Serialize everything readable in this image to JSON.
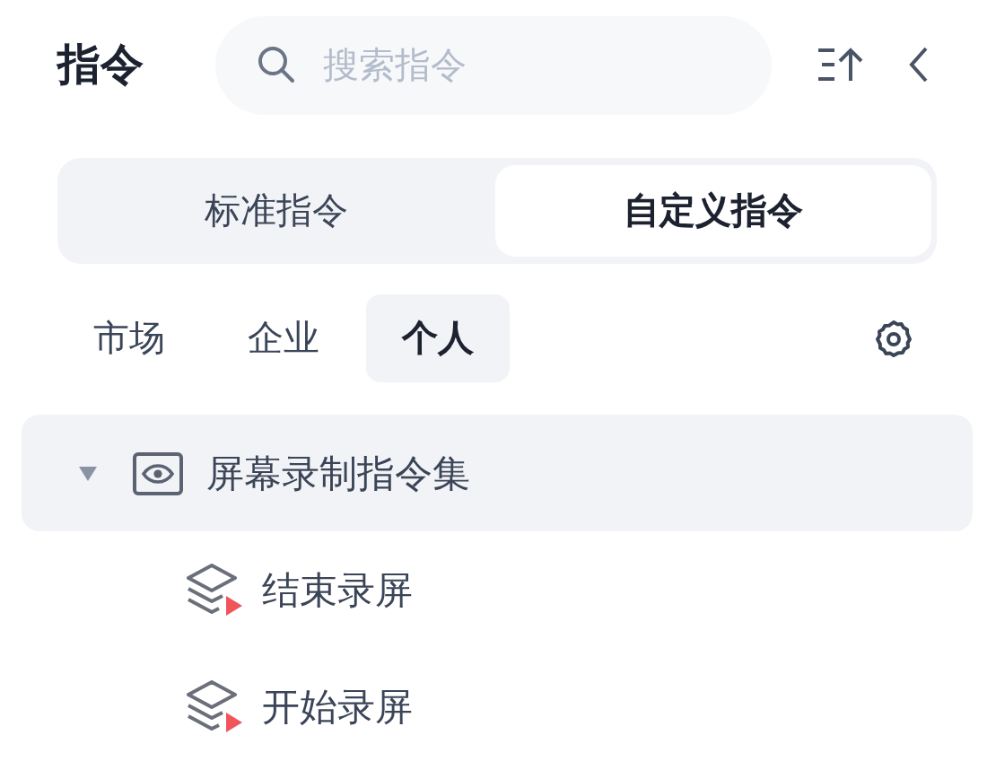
{
  "header": {
    "title": "指令",
    "search": {
      "placeholder": "搜索指令"
    }
  },
  "mode_tabs": [
    {
      "label": "标准指令",
      "selected": false
    },
    {
      "label": "自定义指令",
      "selected": true
    }
  ],
  "scope_tabs": [
    {
      "label": "市场",
      "selected": false
    },
    {
      "label": "企业",
      "selected": false
    },
    {
      "label": "个人",
      "selected": true
    }
  ],
  "tree": [
    {
      "label": "屏幕录制指令集",
      "expanded": true,
      "selected": true,
      "children": [
        {
          "label": "结束录屏"
        },
        {
          "label": "开始录屏"
        }
      ]
    }
  ]
}
